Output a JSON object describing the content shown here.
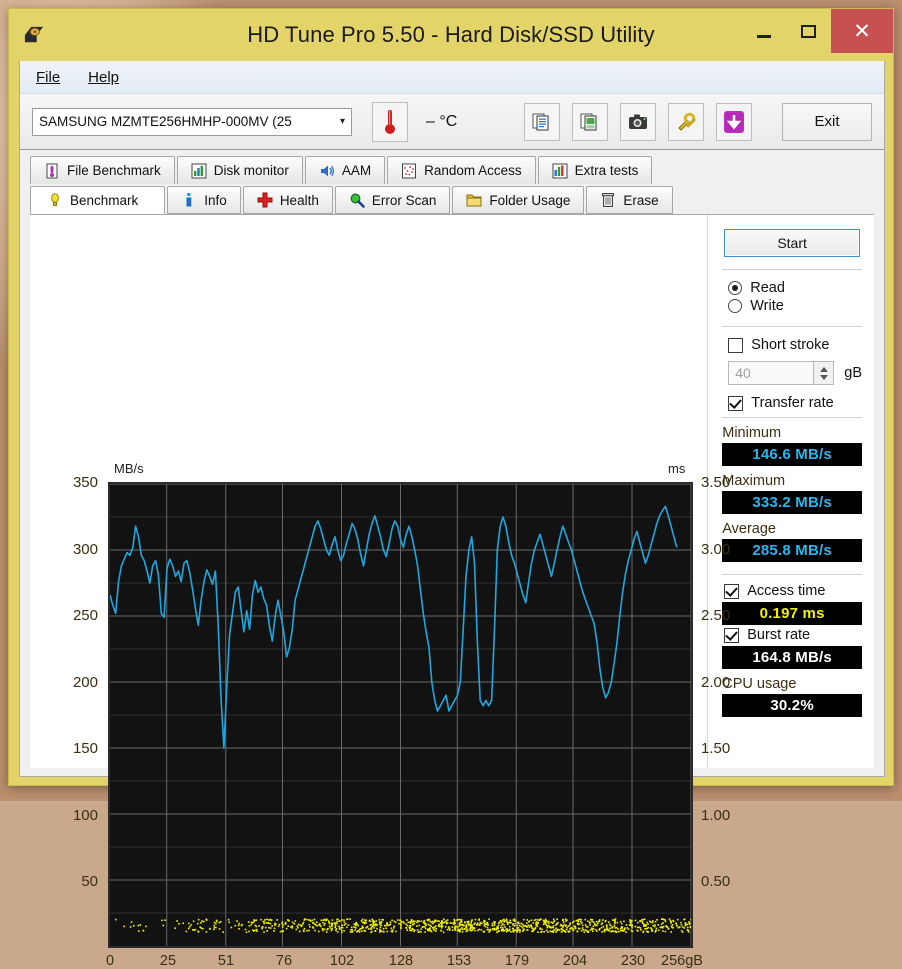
{
  "window": {
    "title": "HD Tune Pro 5.50 - Hard Disk/SSD Utility",
    "app_icon": "hard-disk-icon",
    "minimize": "–",
    "maximize": "□",
    "close": "✕",
    "titlebar_color": "#e3d469",
    "close_color": "#c75050"
  },
  "menu": {
    "items": [
      {
        "label": "File",
        "accel": "F"
      },
      {
        "label": "Help",
        "accel": "H"
      }
    ]
  },
  "toolbar": {
    "drive": "SAMSUNG MZMTE256HMHP-000MV (25",
    "drive_caret": "⌄",
    "temperature": "– °C",
    "thermometer_icon": "thermometer-icon",
    "buttons": [
      {
        "icon": "copy-text-icon",
        "name": "copy-text-button"
      },
      {
        "icon": "copy-image-icon",
        "name": "copy-image-button"
      },
      {
        "icon": "camera-icon",
        "name": "screenshot-button"
      },
      {
        "icon": "tools-icon",
        "name": "options-button"
      },
      {
        "icon": "download-icon",
        "name": "save-button"
      }
    ],
    "exit_label": "Exit"
  },
  "tabs": {
    "top_row": [
      {
        "label": "File Benchmark",
        "icon": "file-benchmark-icon"
      },
      {
        "label": "Disk monitor",
        "icon": "bar-chart-icon"
      },
      {
        "label": "AAM",
        "icon": "speaker-icon"
      },
      {
        "label": "Random Access",
        "icon": "scatter-icon"
      },
      {
        "label": "Extra tests",
        "icon": "extra-tests-icon"
      }
    ],
    "bottom_row": [
      {
        "label": "Benchmark",
        "icon": "bulb-icon",
        "active": true
      },
      {
        "label": "Info",
        "icon": "info-icon",
        "active": false
      },
      {
        "label": "Health",
        "icon": "health-cross-icon",
        "active": false
      },
      {
        "label": "Error Scan",
        "icon": "magnifier-icon",
        "active": false
      },
      {
        "label": "Folder Usage",
        "icon": "folder-icon",
        "active": false
      },
      {
        "label": "Erase",
        "icon": "trash-icon",
        "active": false
      }
    ]
  },
  "controls": {
    "start_label": "Start",
    "read_label": "Read",
    "write_label": "Write",
    "read_selected": true,
    "write_selected": false,
    "short_stroke_label": "Short stroke",
    "short_stroke_checked": false,
    "short_stroke_value": "40",
    "short_stroke_unit": "gB",
    "transfer_rate_label": "Transfer rate",
    "transfer_rate_checked": true,
    "access_time_label": "Access time",
    "access_time_checked": true,
    "burst_rate_label": "Burst rate",
    "burst_rate_checked": true
  },
  "results": {
    "minimum_label": "Minimum",
    "minimum_value": "146.6 MB/s",
    "maximum_label": "Maximum",
    "maximum_value": "333.2 MB/s",
    "average_label": "Average",
    "average_value": "285.8 MB/s",
    "access_time_value": "0.197 ms",
    "burst_rate_value": "164.8 MB/s",
    "cpu_usage_label": "CPU usage",
    "cpu_usage_value": "30.2%"
  },
  "chart_data": {
    "type": "line",
    "title": "",
    "ylabel": "MB/s",
    "ylabel_right": "ms",
    "xlabel": "256gB",
    "xlim": [
      0,
      256
    ],
    "ylim": [
      0,
      350
    ],
    "ylim_right": [
      0,
      3.5
    ],
    "grid": true,
    "background": "#121212",
    "y_ticks": [
      350,
      300,
      250,
      200,
      150,
      100,
      50
    ],
    "y_ticks_right": [
      "3.50",
      "3.00",
      "2.50",
      "2.00",
      "1.50",
      "1.00",
      "0.50"
    ],
    "x_ticks": [
      0,
      25,
      51,
      76,
      102,
      128,
      153,
      179,
      204,
      230,
      256
    ],
    "x_tick_labels": [
      "0",
      "25",
      "51",
      "76",
      "102",
      "128",
      "153",
      "179",
      "204",
      "230",
      "256gB"
    ],
    "series": [
      {
        "name": "Transfer rate",
        "color": "#1fa8e0",
        "unit": "MB/s",
        "x": [
          0,
          1,
          2,
          3,
          4,
          5,
          6,
          7,
          8,
          9,
          10,
          11,
          12,
          13,
          14,
          15,
          16,
          17,
          18,
          19,
          20,
          21,
          22,
          23,
          24,
          25,
          26,
          27,
          28,
          29,
          30,
          31,
          32,
          33,
          34,
          35,
          36,
          37,
          38,
          39,
          40,
          41,
          42,
          43,
          44,
          45,
          46,
          47,
          48,
          49,
          50,
          51,
          52,
          53,
          54,
          55,
          56,
          57,
          58,
          59,
          60,
          61,
          62,
          63,
          64,
          65,
          66,
          67,
          68,
          69,
          70,
          71,
          72,
          73,
          74,
          75,
          76,
          77,
          78,
          79,
          80,
          81,
          82,
          83,
          84,
          85,
          86,
          87,
          88,
          89,
          90,
          91,
          92,
          93,
          94,
          95,
          96,
          97,
          98,
          99,
          100,
          101,
          102,
          103,
          104,
          105,
          106,
          107,
          108,
          109,
          110,
          111,
          112,
          113,
          114,
          115,
          116,
          117,
          118,
          119,
          120,
          121,
          122,
          123,
          124,
          125,
          126,
          127,
          128,
          129,
          130,
          131,
          132,
          133,
          134,
          135,
          136,
          137,
          138,
          139,
          140,
          141,
          142,
          143,
          144,
          145,
          146,
          147,
          148,
          149,
          150,
          151,
          152,
          153,
          154,
          155,
          156,
          157,
          158,
          159,
          160,
          161,
          162,
          163,
          164,
          165,
          166,
          167,
          168,
          169,
          170,
          171,
          172,
          173,
          174,
          175,
          176,
          177,
          178,
          179,
          180,
          181,
          182,
          183,
          184,
          185,
          186,
          187,
          188,
          189,
          190,
          191,
          192,
          193,
          194,
          195,
          196,
          197,
          198,
          199
        ],
        "values": [
          266,
          258,
          252,
          276,
          288,
          293,
          298,
          296,
          302,
          318,
          310,
          296,
          292,
          284,
          275,
          288,
          292,
          281,
          252,
          249,
          286,
          293,
          288,
          280,
          284,
          276,
          290,
          292,
          283,
          270,
          256,
          243,
          262,
          276,
          285,
          280,
          274,
          284,
          243,
          187,
          150,
          197,
          236,
          252,
          268,
          272,
          255,
          238,
          254,
          240,
          266,
          277,
          268,
          272,
          263,
          258,
          242,
          231,
          250,
          262,
          250,
          238,
          219,
          226,
          240,
          262,
          270,
          278,
          286,
          294,
          302,
          310,
          318,
          322,
          316,
          308,
          300,
          296,
          304,
          310,
          300,
          292,
          296,
          305,
          312,
          320,
          316,
          308,
          297,
          288,
          300,
          312,
          320,
          326,
          318,
          310,
          300,
          295,
          305,
          316,
          322,
          318,
          308,
          302,
          312,
          318,
          310,
          300,
          288,
          270,
          252,
          238,
          226,
          200,
          186,
          178,
          182,
          186,
          190,
          178,
          182,
          186,
          190,
          200,
          240,
          280,
          300,
          310,
          290,
          230,
          186,
          182,
          186,
          182,
          186,
          240,
          300,
          318,
          325,
          318,
          306,
          296,
          290,
          282,
          274,
          266,
          260,
          276,
          290,
          300,
          306,
          312,
          304,
          296,
          288,
          280,
          290,
          300,
          310,
          318,
          312,
          306,
          300,
          292,
          284,
          276,
          268,
          262,
          256,
          250,
          244,
          230,
          210,
          196,
          188,
          192,
          200,
          214,
          230,
          250,
          268,
          282,
          292,
          300,
          308,
          314,
          306,
          298,
          290,
          296,
          304,
          312,
          320,
          326,
          330,
          333,
          326,
          318,
          310,
          302,
          296,
          290,
          284,
          292,
          300
        ]
      },
      {
        "name": "Access time",
        "color": "#f2f200",
        "unit": "ms",
        "typical_value": 0.197,
        "description": "Dense cluster of yellow scatter points near the bottom of the plot, concentrated between approximately 0.10 and 0.25 ms, very dense on the left half of the capacity range and progressively sparser toward the right."
      }
    ]
  }
}
